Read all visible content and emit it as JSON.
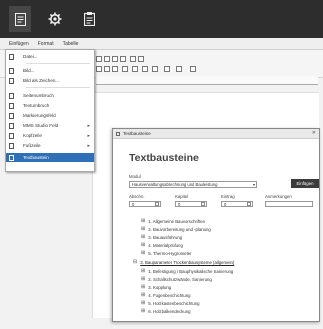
{
  "topbar": {
    "buttons": [
      {
        "name": "document-icon",
        "active": true
      },
      {
        "name": "gear-icon",
        "active": false
      },
      {
        "name": "clipboard-icon",
        "active": false
      }
    ]
  },
  "menubar": {
    "items": [
      "Einfügen",
      "Format",
      "Tabelle"
    ]
  },
  "menu": {
    "items": [
      {
        "label": "Datei...",
        "arrow": ""
      },
      {
        "label": "Bild...",
        "arrow": ""
      },
      {
        "label": "Bild als Zeichen...",
        "arrow": ""
      },
      {
        "label": "Seitenumbruch",
        "arrow": ""
      },
      {
        "label": "Textumbruch",
        "arrow": ""
      },
      {
        "label": "Markierungsfeld",
        "arrow": ""
      },
      {
        "label": "MMS Studio Feld",
        "arrow": "▸"
      },
      {
        "label": "Kopfzeile",
        "arrow": "▸"
      },
      {
        "label": "Fußzeile",
        "arrow": "▸"
      },
      {
        "label": "Textbaustein",
        "arrow": ""
      }
    ]
  },
  "dialog": {
    "window_title": "Textbausteine",
    "heading": "Textbausteine",
    "modul_label": "Modul",
    "modul_value": "Hausverwaltungsabrechnung und Bauleistung",
    "button": "Einfügen",
    "fields": [
      {
        "label": "Abschn.",
        "value": "0"
      },
      {
        "label": "Kapitel",
        "value": "0"
      },
      {
        "label": "Eintrag",
        "value": "0"
      },
      {
        "label": "Anmerkungen",
        "value": ""
      }
    ],
    "tree": [
      {
        "label": "1. Allgemeine Bauvorschriften",
        "root": false
      },
      {
        "label": "2. Bauvorbereitung und -planung",
        "root": false
      },
      {
        "label": "3. Bauausführung",
        "root": false
      },
      {
        "label": "4. Materialprüfung",
        "root": false
      },
      {
        "label": "5. Thermo-Hygrometer",
        "root": false
      },
      {
        "label": "3. Bauparameter Trockenbausysteme (allgemein)",
        "root": true
      },
      {
        "label": "1. Befestigung / Bauphysikalische Sanierung",
        "root": false
      },
      {
        "label": "2. Schallschutzwände, Sanierung",
        "root": false
      },
      {
        "label": "3. Kopplung",
        "root": false
      },
      {
        "label": "4. Fugenbeschichtung",
        "root": false
      },
      {
        "label": "5. Holzkastenbeschichtung",
        "root": false
      },
      {
        "label": "6. Holzbalkendeckung",
        "root": false
      }
    ]
  }
}
